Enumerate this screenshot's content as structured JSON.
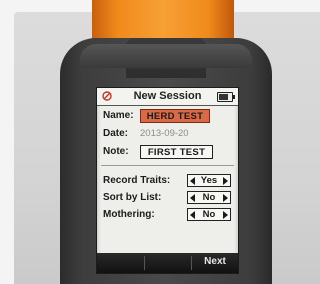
{
  "screen": {
    "title": "New Session",
    "name_label": "Name:",
    "name_value": "HERD TEST",
    "date_label": "Date:",
    "date_value": "2013-09-20",
    "note_label": "Note:",
    "note_value": "FIRST TEST",
    "settings": [
      {
        "label": "Record Traits:",
        "value": "Yes"
      },
      {
        "label": "Sort by List:",
        "value": "No"
      },
      {
        "label": "Mothering:",
        "value": "No"
      }
    ],
    "softkeys": [
      "",
      "",
      "Next"
    ]
  },
  "colors": {
    "device_orange": "#f08a1c",
    "device_body": "#3d3d3d",
    "highlight_field": "#d96a45",
    "screen_bg": "#eeeeea"
  },
  "icons": {
    "status_left": "signal-off-icon",
    "status_right": "battery-icon",
    "selector_prev": "arrow-left-icon",
    "selector_next": "arrow-right-icon"
  }
}
